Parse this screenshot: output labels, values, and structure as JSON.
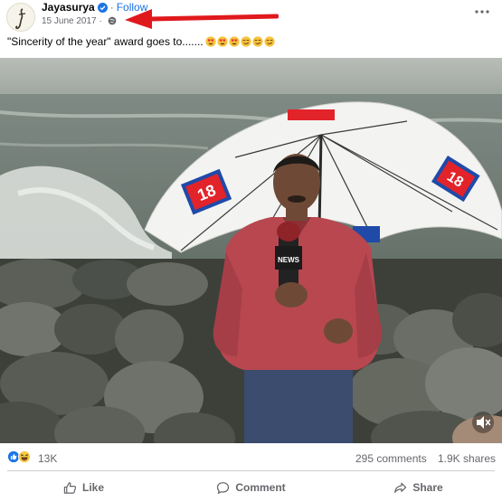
{
  "post": {
    "author": "Jayasurya",
    "follow_label": "Follow",
    "date": "15 June 2017",
    "caption": "\"Sincerity of the year\" award goes to......."
  },
  "caption_emojis": [
    "heart-eyes",
    "heart-eyes",
    "heart-eyes",
    "smirk",
    "smirk",
    "smirk"
  ],
  "video": {
    "channel_logo_text": "18",
    "mic_flag_text": "NEWS"
  },
  "stats": {
    "reaction_icons": [
      "like-icon",
      "haha-icon"
    ],
    "reaction_count": "13K",
    "comments": "295 comments",
    "shares": "1.9K shares"
  },
  "actions": {
    "like": "Like",
    "comment": "Comment",
    "share": "Share"
  },
  "colors": {
    "accent_blue": "#1b74e4",
    "annotation_red": "#e0191d",
    "muted_text": "#65676b"
  }
}
